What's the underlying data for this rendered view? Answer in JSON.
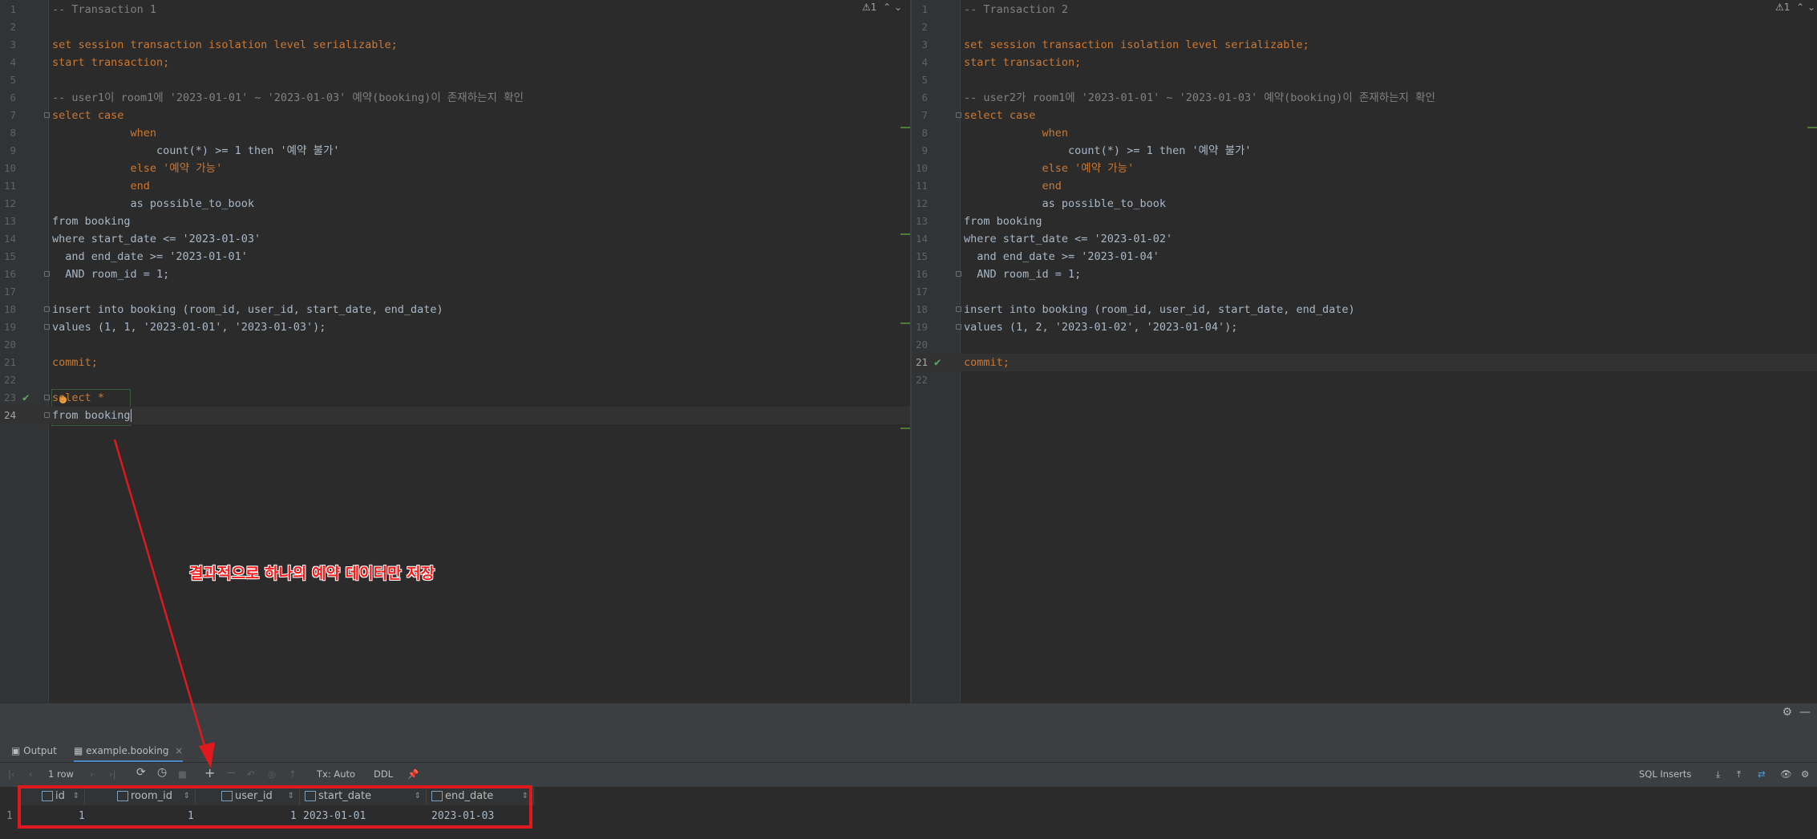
{
  "editor_left": {
    "lines": [
      "-- Transaction 1",
      "",
      "set session transaction isolation level serializable;",
      "start transaction;",
      "",
      "-- user1이 room1에 '2023-01-01' ~ '2023-01-03' 예약(booking)이 존재하는지 확인",
      "select case",
      "            when",
      "                count(*) >= 1 then '예약 불가'",
      "            else '예약 가능'",
      "            end",
      "            as possible_to_book",
      "from booking",
      "where start_date <= '2023-01-03'",
      "  and end_date >= '2023-01-01'",
      "  AND room_id = 1;",
      "",
      "insert into booking (room_id, user_id, start_date, end_date)",
      "values (1, 1, '2023-01-01', '2023-01-03');",
      "",
      "commit;",
      "",
      "select *",
      "from booking"
    ],
    "warning_count": "1"
  },
  "editor_right": {
    "lines": [
      "-- Transaction 2",
      "",
      "set session transaction isolation level serializable;",
      "start transaction;",
      "",
      "-- user2가 room1에 '2023-01-01' ~ '2023-01-03' 예약(booking)이 존재하는지 확인",
      "select case",
      "            when",
      "                count(*) >= 1 then '예약 불가'",
      "            else '예약 가능'",
      "            end",
      "            as possible_to_book",
      "from booking",
      "where start_date <= '2023-01-02'",
      "  and end_date >= '2023-01-04'",
      "  AND room_id = 1;",
      "",
      "insert into booking (room_id, user_id, start_date, end_date)",
      "values (1, 2, '2023-01-02', '2023-01-04');",
      "",
      "commit;",
      ""
    ],
    "warning_count": "1"
  },
  "tabs": {
    "output": "Output",
    "result": "example.booking"
  },
  "toolbar": {
    "rows": "1 row",
    "tx": "Tx: Auto",
    "ddl": "DDL",
    "export_format": "SQL Inserts"
  },
  "result_grid": {
    "columns": [
      "id",
      "room_id",
      "user_id",
      "start_date",
      "end_date"
    ],
    "rows": [
      {
        "row_number": "1",
        "id": "1",
        "room_id": "1",
        "user_id": "1",
        "start_date": "2023-01-01",
        "end_date": "2023-01-03"
      }
    ]
  },
  "annotation": {
    "text": "결과적으로 하나의 예약 데이터만 저장",
    "color": "#ff1a1a"
  },
  "icons": [
    "warning-icon",
    "chevron-up-icon",
    "chevron-down-icon",
    "checkmark-icon",
    "gear-icon",
    "minimize-icon",
    "refresh-icon",
    "add-row-icon",
    "pin-icon",
    "download-icon",
    "eye-icon"
  ]
}
